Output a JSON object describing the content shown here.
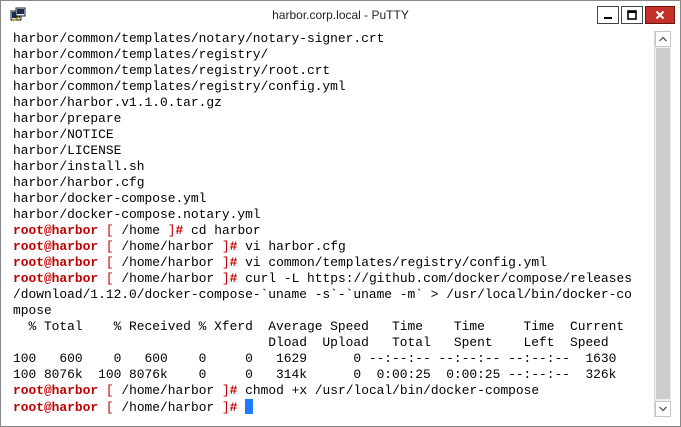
{
  "window": {
    "title": "harbor.corp.local - PuTTY",
    "icon": "putty-terminal-icon",
    "controls": [
      "minimize",
      "maximize",
      "close"
    ]
  },
  "prompt": {
    "user": "root@harbor",
    "open_bracket": "[",
    "close_bracket": "]",
    "hash": "#"
  },
  "colors": {
    "prompt": "#c00000",
    "cursor": "#1e7cff",
    "close_button": "#c4312b"
  },
  "terminal": {
    "lines": [
      {
        "text": "harbor/common/templates/notary/notary-signer.crt"
      },
      {
        "text": "harbor/common/templates/registry/"
      },
      {
        "text": "harbor/common/templates/registry/root.crt"
      },
      {
        "text": "harbor/common/templates/registry/config.yml"
      },
      {
        "text": "harbor/harbor.v1.1.0.tar.gz"
      },
      {
        "text": "harbor/prepare"
      },
      {
        "text": "harbor/NOTICE"
      },
      {
        "text": "harbor/LICENSE"
      },
      {
        "text": "harbor/install.sh"
      },
      {
        "text": "harbor/harbor.cfg"
      },
      {
        "text": "harbor/docker-compose.yml"
      },
      {
        "text": "harbor/docker-compose.notary.yml"
      },
      {
        "prompt": true,
        "path": "/home",
        "cmd": "cd harbor"
      },
      {
        "prompt": true,
        "path": "/home/harbor",
        "cmd": "vi harbor.cfg"
      },
      {
        "prompt": true,
        "path": "/home/harbor",
        "cmd": "vi common/templates/registry/config.yml"
      },
      {
        "prompt": true,
        "path": "/home/harbor",
        "cmd": "curl -L https://github.com/docker/compose/releases"
      },
      {
        "text": "/download/1.12.0/docker-compose-`uname -s`-`uname -m` > /usr/local/bin/docker-co"
      },
      {
        "text": "mpose"
      },
      {
        "text": "  % Total    % Received % Xferd  Average Speed   Time    Time     Time  Current"
      },
      {
        "text": "                                 Dload  Upload   Total   Spent    Left  Speed"
      },
      {
        "text": "100   600    0   600    0     0   1629      0 --:--:-- --:--:-- --:--:--  1630"
      },
      {
        "text": "100 8076k  100 8076k    0     0   314k      0  0:00:25  0:00:25 --:--:--  326k"
      },
      {
        "prompt": true,
        "path": "/home/harbor",
        "cmd": "chmod +x /usr/local/bin/docker-compose"
      },
      {
        "prompt": true,
        "path": "/home/harbor",
        "cmd": "",
        "cursor": true
      }
    ]
  }
}
